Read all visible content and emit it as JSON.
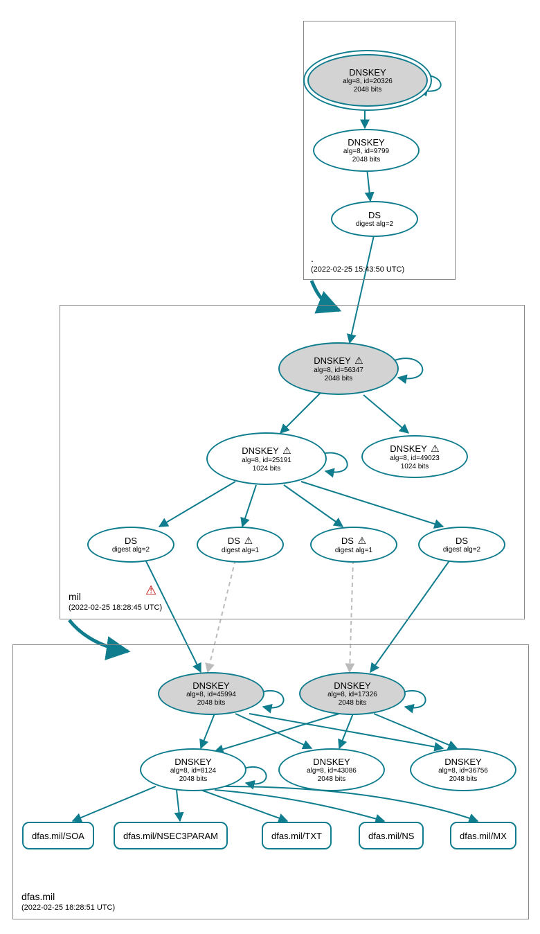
{
  "zones": {
    "root": {
      "name": ".",
      "timestamp": "(2022-02-25 15:43:50 UTC)"
    },
    "mil": {
      "name": "mil",
      "timestamp": "(2022-02-25 18:28:45 UTC)"
    },
    "dfas": {
      "name": "dfas.mil",
      "timestamp": "(2022-02-25 18:28:51 UTC)"
    }
  },
  "nodes": {
    "root_ksk": {
      "title": "DNSKEY",
      "l1": "alg=8, id=20326",
      "l2": "2048 bits"
    },
    "root_zsk": {
      "title": "DNSKEY",
      "l1": "alg=8, id=9799",
      "l2": "2048 bits"
    },
    "root_ds": {
      "title": "DS",
      "l1": "digest alg=2"
    },
    "mil_ksk": {
      "title": "DNSKEY",
      "warn": true,
      "l1": "alg=8, id=56347",
      "l2": "2048 bits"
    },
    "mil_zsk1": {
      "title": "DNSKEY",
      "warn": true,
      "l1": "alg=8, id=25191",
      "l2": "1024 bits"
    },
    "mil_zsk2": {
      "title": "DNSKEY",
      "warn": true,
      "l1": "alg=8, id=49023",
      "l2": "1024 bits"
    },
    "mil_ds1": {
      "title": "DS",
      "l1": "digest alg=2"
    },
    "mil_ds2": {
      "title": "DS",
      "warn": true,
      "l1": "digest alg=1"
    },
    "mil_ds3": {
      "title": "DS",
      "warn": true,
      "l1": "digest alg=1"
    },
    "mil_ds4": {
      "title": "DS",
      "l1": "digest alg=2"
    },
    "dfas_ksk1": {
      "title": "DNSKEY",
      "l1": "alg=8, id=45994",
      "l2": "2048 bits"
    },
    "dfas_ksk2": {
      "title": "DNSKEY",
      "l1": "alg=8, id=17326",
      "l2": "2048 bits"
    },
    "dfas_zsk1": {
      "title": "DNSKEY",
      "l1": "alg=8, id=8124",
      "l2": "2048 bits"
    },
    "dfas_zsk2": {
      "title": "DNSKEY",
      "l1": "alg=8, id=43086",
      "l2": "2048 bits"
    },
    "dfas_zsk3": {
      "title": "DNSKEY",
      "l1": "alg=8, id=36756",
      "l2": "2048 bits"
    },
    "rr_soa": {
      "label": "dfas.mil/SOA"
    },
    "rr_nsec": {
      "label": "dfas.mil/NSEC3PARAM"
    },
    "rr_txt": {
      "label": "dfas.mil/TXT"
    },
    "rr_ns": {
      "label": "dfas.mil/NS"
    },
    "rr_mx": {
      "label": "dfas.mil/MX"
    }
  },
  "icons": {
    "warn": "⚠",
    "err": "⚠"
  },
  "colors": {
    "stroke": "#107d8e",
    "dashed": "#bbbbbb"
  }
}
